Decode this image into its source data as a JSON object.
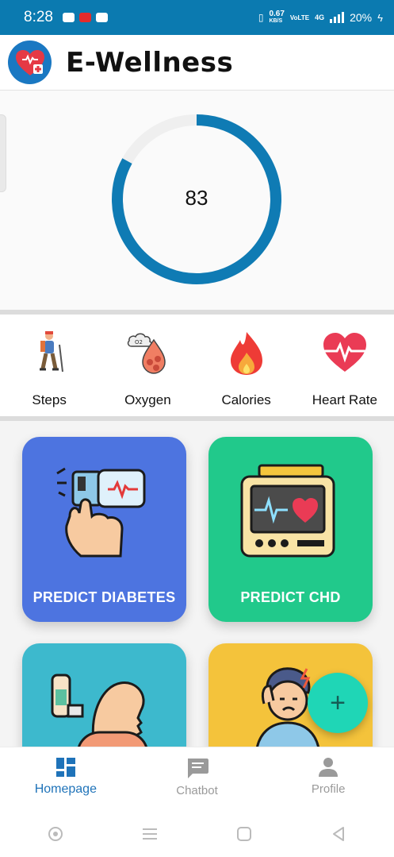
{
  "status_bar": {
    "time": "8:28",
    "net_speed": "0.67",
    "net_unit": "KB/S",
    "volte": "VoLTE",
    "network": "4G",
    "battery": "20%"
  },
  "app_bar": {
    "title": "E-Wellness",
    "logo_icon": "heart-plus-icon"
  },
  "score": {
    "value": "83",
    "progress_fraction": 0.83,
    "ring_color": "#0f7bb4",
    "track_color": "#efefef"
  },
  "metrics": [
    {
      "label": "Steps",
      "icon": "hiker-icon"
    },
    {
      "label": "Oxygen",
      "icon": "oxygen-blood-icon"
    },
    {
      "label": "Calories",
      "icon": "flame-icon"
    },
    {
      "label": "Heart Rate",
      "icon": "heart-rate-icon"
    }
  ],
  "cards": [
    {
      "label": "PREDICT DIABETES",
      "color": "#4d74e0",
      "icon": "glucose-meter-icon"
    },
    {
      "label": "PREDICT CHD",
      "color": "#21c98b",
      "icon": "heart-monitor-icon"
    },
    {
      "label": "",
      "color": "#3db9cd",
      "icon": "inhaler-lungs-icon"
    },
    {
      "label": "",
      "color": "#f4c33b",
      "icon": "stressed-person-icon"
    }
  ],
  "fab": {
    "symbol": "+"
  },
  "bottom_nav": {
    "items": [
      {
        "label": "Homepage",
        "icon": "dashboard-icon",
        "active": true
      },
      {
        "label": "Chatbot",
        "icon": "chat-icon",
        "active": false
      },
      {
        "label": "Profile",
        "icon": "person-icon",
        "active": false
      }
    ],
    "active_color": "#1f73b9",
    "inactive_color": "#9a9a9a"
  },
  "system_nav": [
    "screenshot-icon",
    "menu-icon",
    "home-icon",
    "back-icon"
  ]
}
